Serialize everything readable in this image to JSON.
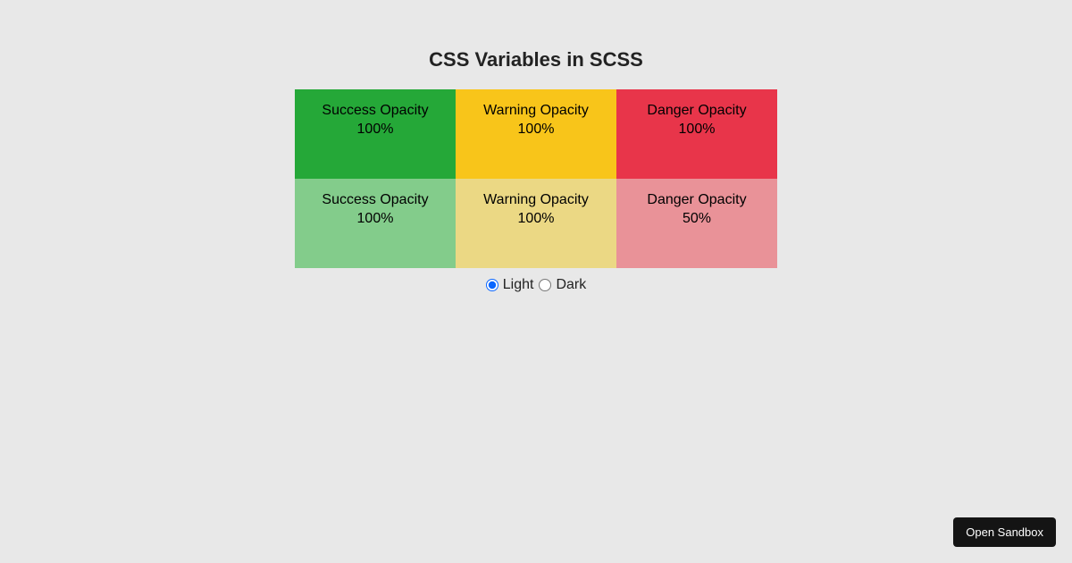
{
  "title": "CSS Variables in SCSS",
  "grid": {
    "rows": [
      [
        {
          "label": "Success Opacity",
          "value": "100%",
          "variant": "success",
          "interactable": false
        },
        {
          "label": "Warning Opacity",
          "value": "100%",
          "variant": "warning",
          "interactable": false
        },
        {
          "label": "Danger Opacity",
          "value": "100%",
          "variant": "danger",
          "interactable": false
        }
      ],
      [
        {
          "label": "Success Opacity",
          "value": "100%",
          "variant": "success-muted",
          "interactable": false
        },
        {
          "label": "Warning Opacity",
          "value": "100%",
          "variant": "warning-muted",
          "interactable": false
        },
        {
          "label": "Danger Opacity",
          "value": "50%",
          "variant": "danger-muted",
          "interactable": false
        }
      ]
    ]
  },
  "theme": {
    "light_label": "Light",
    "dark_label": "Dark",
    "selected": "light"
  },
  "sandbox_button": "Open Sandbox",
  "colors": {
    "success": "#25a838",
    "warning": "#f8c51a",
    "danger": "#e8354a",
    "success_muted": "#83cc8b",
    "warning_muted": "#ebd884",
    "danger_muted": "#e99298",
    "background": "#e8e8e8"
  }
}
